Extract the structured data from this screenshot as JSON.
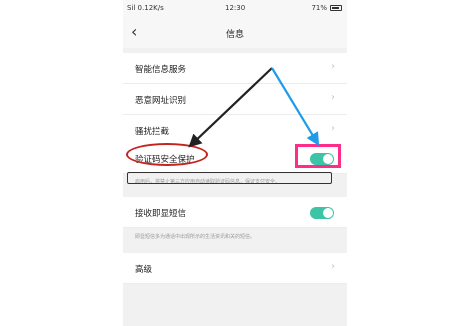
{
  "status_bar": {
    "signal": "Sil 0.12K/s",
    "time": "12:30",
    "battery": "71%"
  },
  "nav": {
    "back_icon": "chevron-left-icon",
    "title": "信息"
  },
  "rows": [
    {
      "label": "智能信息服务",
      "control": "chevron"
    },
    {
      "label": "恶意网址识别",
      "control": "chevron"
    },
    {
      "label": "骚扰拦截",
      "control": "chevron"
    },
    {
      "label": "验证码安全保护",
      "control": "toggle",
      "on": true
    },
    {
      "label": "接收即显短信",
      "control": "toggle",
      "on": true
    },
    {
      "label": "高级",
      "control": "chevron"
    }
  ],
  "notes": {
    "verify_note": "启用后，将禁止第三方应用自动读取验证码信息，保证支付安全。",
    "flash_note": "即显短信多为通话中出现所示的生活资讯和关的短信。"
  },
  "colors": {
    "toggle_on": "#3cc4a7",
    "annotation_pink": "#ff2d8a",
    "annotation_red": "#c4241c",
    "arrow_blue": "#1e9be9",
    "arrow_black": "#222222"
  }
}
